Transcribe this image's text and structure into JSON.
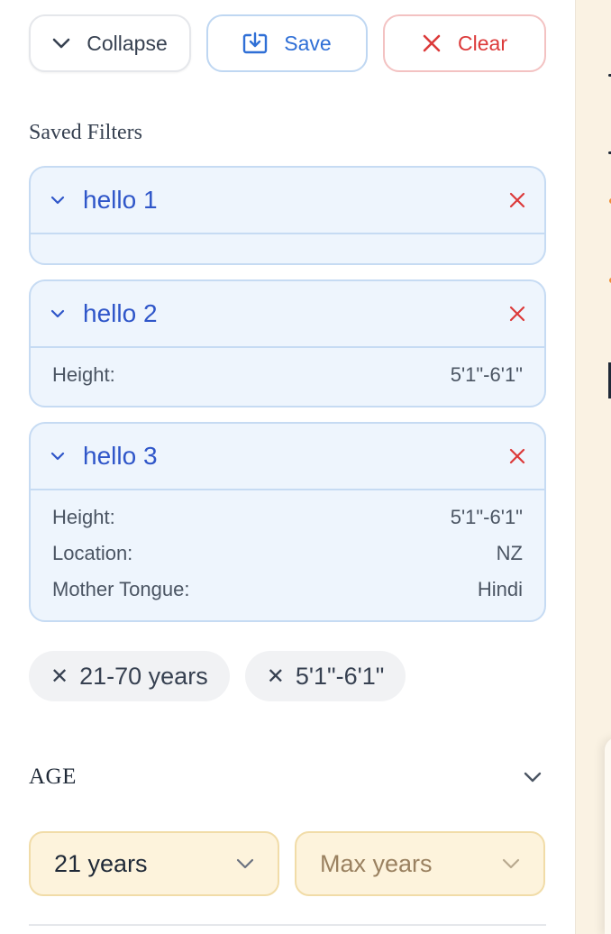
{
  "toolbar": {
    "collapse_label": "Collapse",
    "save_label": "Save",
    "clear_label": "Clear"
  },
  "saved_filters": {
    "title": "Saved Filters",
    "items": [
      {
        "name": "hello 1",
        "rows": []
      },
      {
        "name": "hello 2",
        "rows": [
          {
            "label": "Height:",
            "value": "5'1\"-6'1\""
          }
        ]
      },
      {
        "name": "hello 3",
        "rows": [
          {
            "label": "Height:",
            "value": "5'1\"-6'1\""
          },
          {
            "label": "Location:",
            "value": "NZ"
          },
          {
            "label": "Mother Tongue:",
            "value": "Hindi"
          }
        ]
      }
    ]
  },
  "active_chips": [
    {
      "label": "21-70 years"
    },
    {
      "label": "5'1\"-6'1\""
    }
  ],
  "age": {
    "title": "AGE",
    "min_value": "21 years",
    "max_placeholder": "Max years"
  },
  "colors": {
    "accent_blue": "#2f56c9",
    "danger_red": "#dc3a3a",
    "panel_bg": "#eef5fd",
    "select_bg": "#fdf3dc"
  }
}
